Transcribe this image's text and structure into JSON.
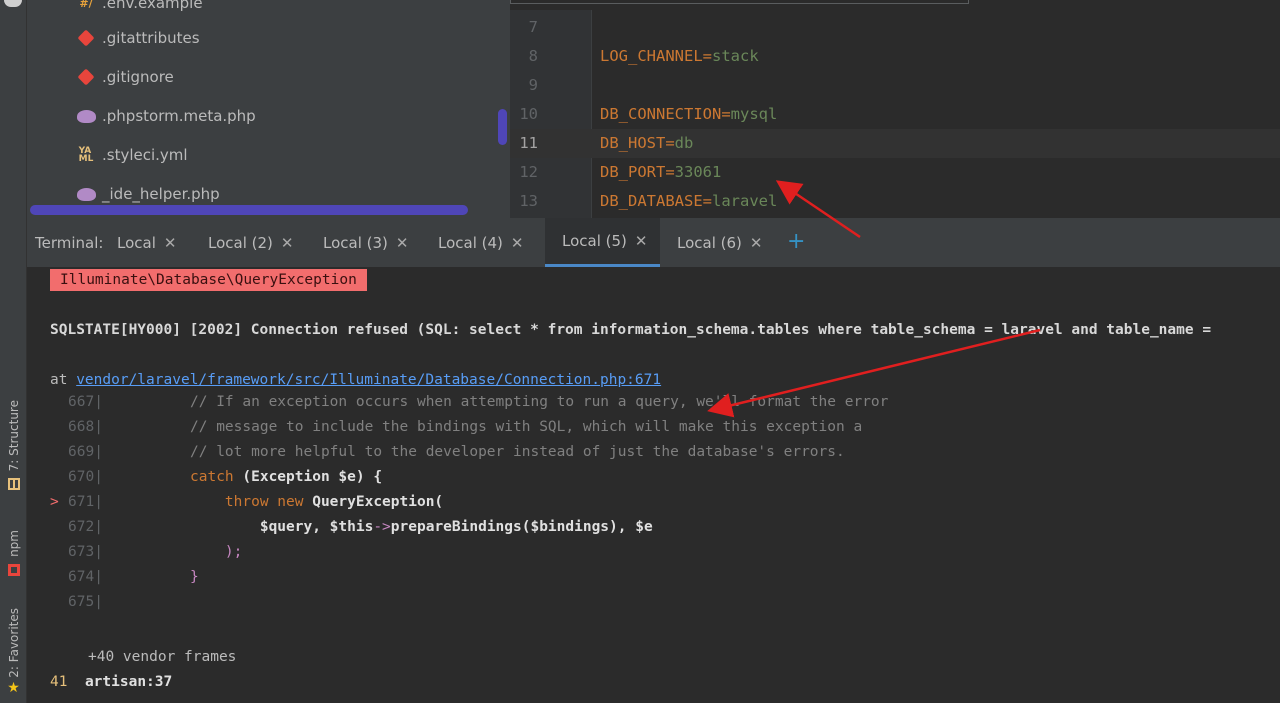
{
  "project_tree": {
    "items": [
      {
        "label": ".env.example",
        "icon": "env-file-icon"
      },
      {
        "label": ".gitattributes",
        "icon": "git-icon"
      },
      {
        "label": ".gitignore",
        "icon": "git-icon"
      },
      {
        "label": ".phpstorm.meta.php",
        "icon": "php-elephant-icon"
      },
      {
        "label": ".styleci.yml",
        "icon": "yaml-icon"
      },
      {
        "label": "_ide_helper.php",
        "icon": "php-elephant-icon"
      }
    ]
  },
  "editor": {
    "lines": [
      {
        "num": "7",
        "key": "",
        "value": ""
      },
      {
        "num": "8",
        "key": "LOG_CHANNEL",
        "value": "stack"
      },
      {
        "num": "9",
        "key": "",
        "value": ""
      },
      {
        "num": "10",
        "key": "DB_CONNECTION",
        "value": "mysql"
      },
      {
        "num": "11",
        "key": "DB_HOST",
        "value": "db"
      },
      {
        "num": "12",
        "key": "DB_PORT",
        "value": "33061"
      },
      {
        "num": "13",
        "key": "DB_DATABASE",
        "value": "laravel"
      }
    ],
    "eq": "="
  },
  "terminal": {
    "label": "Terminal:",
    "tabs": [
      "Local",
      "Local (2)",
      "Local (3)",
      "Local (4)",
      "Local (5)",
      "Local (6)"
    ],
    "active_tab": "Local (5)",
    "close_glyph": "✕",
    "add_glyph": "+",
    "exception": "Illuminate\\Database\\QueryException",
    "sqlstate": "SQLSTATE[HY000] [2002] Connection refused (SQL: select * from information_schema.tables where table_schema = laravel and table_name =",
    "at_prefix": "at ",
    "at_link": "vendor/laravel/framework/src/Illuminate/Database/Connection.php:671",
    "source": [
      {
        "marker": "",
        "num": "667|",
        "parts": [
          {
            "c": "cmt",
            "t": "// If an exception occurs when attempting to run a query, we'll format the error"
          }
        ]
      },
      {
        "marker": "",
        "num": "668|",
        "parts": [
          {
            "c": "cmt",
            "t": "// message to include the bindings with SQL, which will make this exception a"
          }
        ]
      },
      {
        "marker": "",
        "num": "669|",
        "parts": [
          {
            "c": "cmt",
            "t": "// lot more helpful to the developer instead of just the database's errors."
          }
        ]
      },
      {
        "marker": "",
        "num": "670|",
        "parts": [
          {
            "c": "kw",
            "t": "catch "
          },
          {
            "c": "plain",
            "t": "(Exception $e) {"
          }
        ]
      },
      {
        "marker": ">",
        "num": "671|",
        "parts": [
          {
            "c": "kw",
            "t": "    throw new "
          },
          {
            "c": "plain",
            "t": "QueryException("
          }
        ]
      },
      {
        "marker": "",
        "num": "672|",
        "parts": [
          {
            "c": "plain",
            "t": "        $query, $this"
          },
          {
            "c": "var",
            "t": "->"
          },
          {
            "c": "plain",
            "t": "prepareBindings($bindings), $e"
          }
        ]
      },
      {
        "marker": "",
        "num": "673|",
        "parts": [
          {
            "c": "var",
            "t": "    );"
          }
        ]
      },
      {
        "marker": "",
        "num": "674|",
        "parts": [
          {
            "c": "var",
            "t": "}"
          }
        ]
      },
      {
        "marker": "",
        "num": "675|",
        "parts": []
      }
    ],
    "vendor_frames": "+40 vendor frames",
    "artisan_num": "41",
    "artisan_label": "artisan:37"
  },
  "toolstrip": {
    "structure_label": "7: Structure",
    "npm_label": "npm",
    "favorites_label": "2: Favorites"
  },
  "colors": {
    "accent": "#4a88c7",
    "error_badge": "#f26d6d",
    "annotation_arrow": "#e01f1f"
  }
}
